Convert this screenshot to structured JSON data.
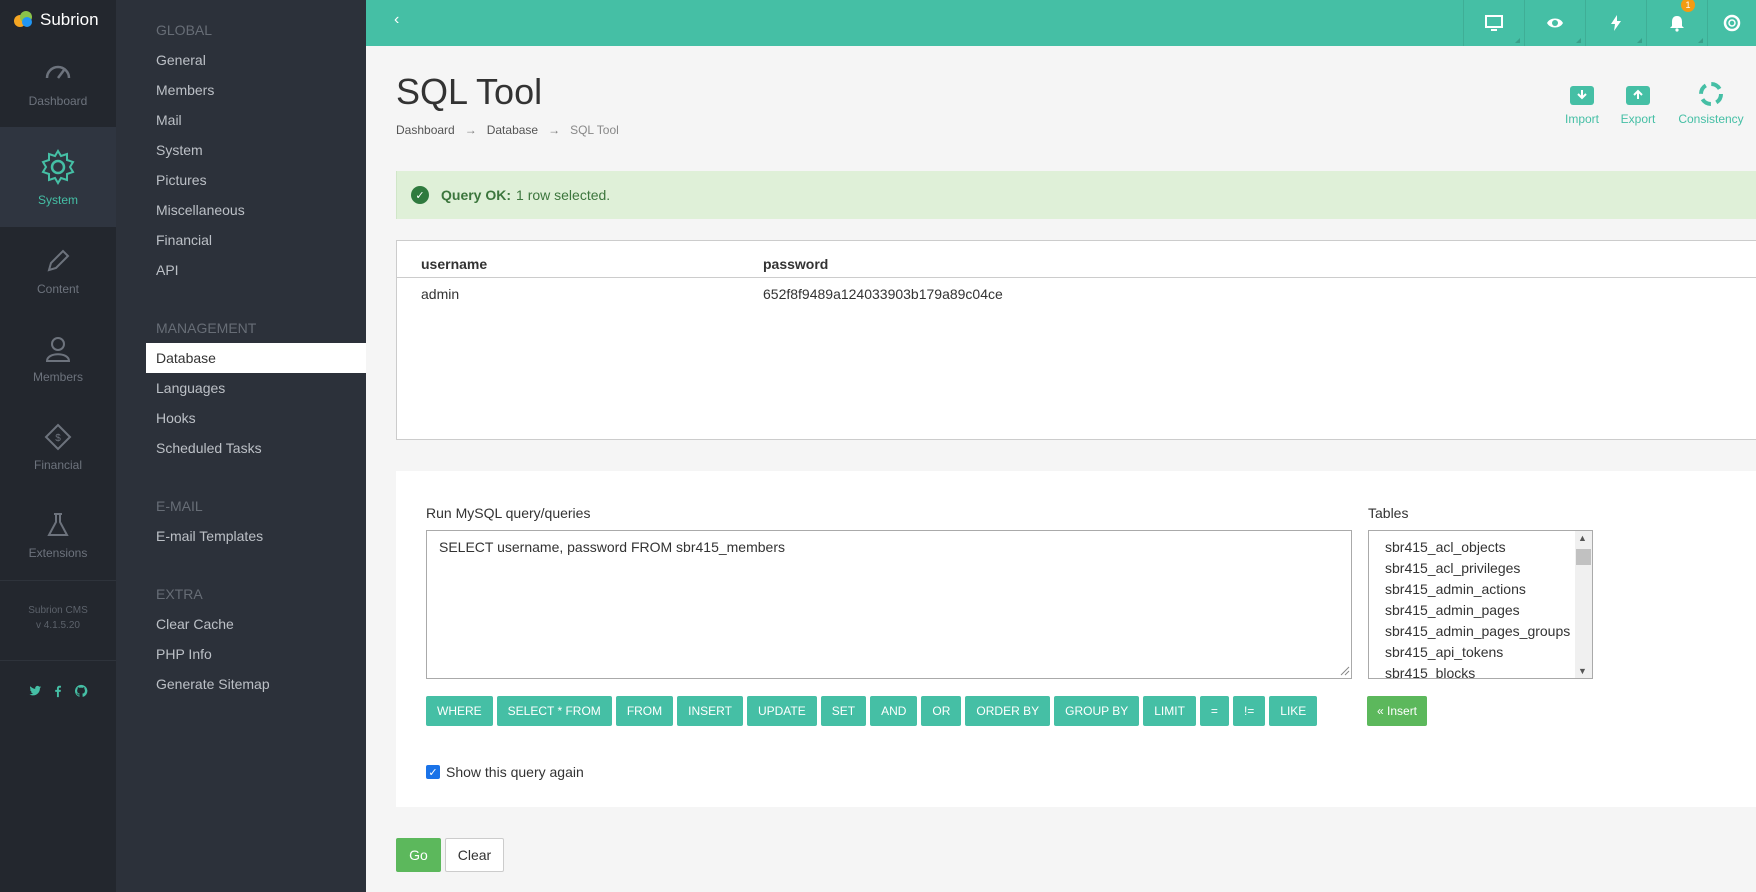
{
  "app": {
    "name": "Subrion",
    "version_line1": "Subrion CMS",
    "version_line2": "v 4.1.5.20"
  },
  "rail": [
    {
      "label": "Dashboard",
      "icon": "gauge-icon"
    },
    {
      "label": "System",
      "icon": "gear-icon",
      "active": true
    },
    {
      "label": "Content",
      "icon": "pencil-icon"
    },
    {
      "label": "Members",
      "icon": "user-icon"
    },
    {
      "label": "Financial",
      "icon": "tag-icon"
    },
    {
      "label": "Extensions",
      "icon": "flask-icon"
    }
  ],
  "social": [
    "twitter-icon",
    "facebook-icon",
    "github-icon"
  ],
  "submenu": {
    "global_head": "GLOBAL",
    "global": [
      "General",
      "Members",
      "Mail",
      "System",
      "Pictures",
      "Miscellaneous",
      "Financial",
      "API"
    ],
    "management_head": "MANAGEMENT",
    "management": [
      "Database",
      "Languages",
      "Hooks",
      "Scheduled Tasks"
    ],
    "email_head": "E-MAIL",
    "email": [
      "E-mail Templates"
    ],
    "extra_head": "EXTRA",
    "extra": [
      "Clear Cache",
      "PHP Info",
      "Generate Sitemap"
    ]
  },
  "topbar": {
    "back": "‹",
    "notification_count": "1",
    "icons": [
      "monitor-icon",
      "eye-icon",
      "bolt-icon",
      "bell-icon",
      "lifebuoy-icon"
    ]
  },
  "page": {
    "title": "SQL Tool",
    "breadcrumb": [
      "Dashboard",
      "Database",
      "SQL Tool"
    ],
    "breadcrumb_sep": "→",
    "actions": [
      "Import",
      "Export",
      "Consistency"
    ]
  },
  "alert": {
    "strong": "Query OK:",
    "text": "1 row selected."
  },
  "result": {
    "columns": [
      "username",
      "password"
    ],
    "rows": [
      [
        "admin",
        "652f8f9489a124033903b179a89c04ce"
      ]
    ]
  },
  "query_panel": {
    "label": "Run MySQL query/queries",
    "query": "SELECT username, password FROM sbr415_members",
    "tables_label": "Tables",
    "tables": [
      "sbr415_acl_objects",
      "sbr415_acl_privileges",
      "sbr415_admin_actions",
      "sbr415_admin_pages",
      "sbr415_admin_pages_groups",
      "sbr415_api_tokens",
      "sbr415_blocks"
    ],
    "buttons": [
      "WHERE",
      "SELECT * FROM",
      "FROM",
      "INSERT",
      "UPDATE",
      "SET",
      "AND",
      "OR",
      "ORDER BY",
      "GROUP BY",
      "LIMIT",
      "=",
      "!=",
      "LIKE"
    ],
    "insert_label": "« Insert",
    "checkbox_label": "Show this query again",
    "checkbox_checked": true
  },
  "footer_buttons": {
    "go": "Go",
    "clear": "Clear"
  },
  "colors": {
    "accent": "#45bfa5",
    "success": "#5cb85c",
    "rail": "#23272e",
    "submenu": "#2c313a"
  }
}
